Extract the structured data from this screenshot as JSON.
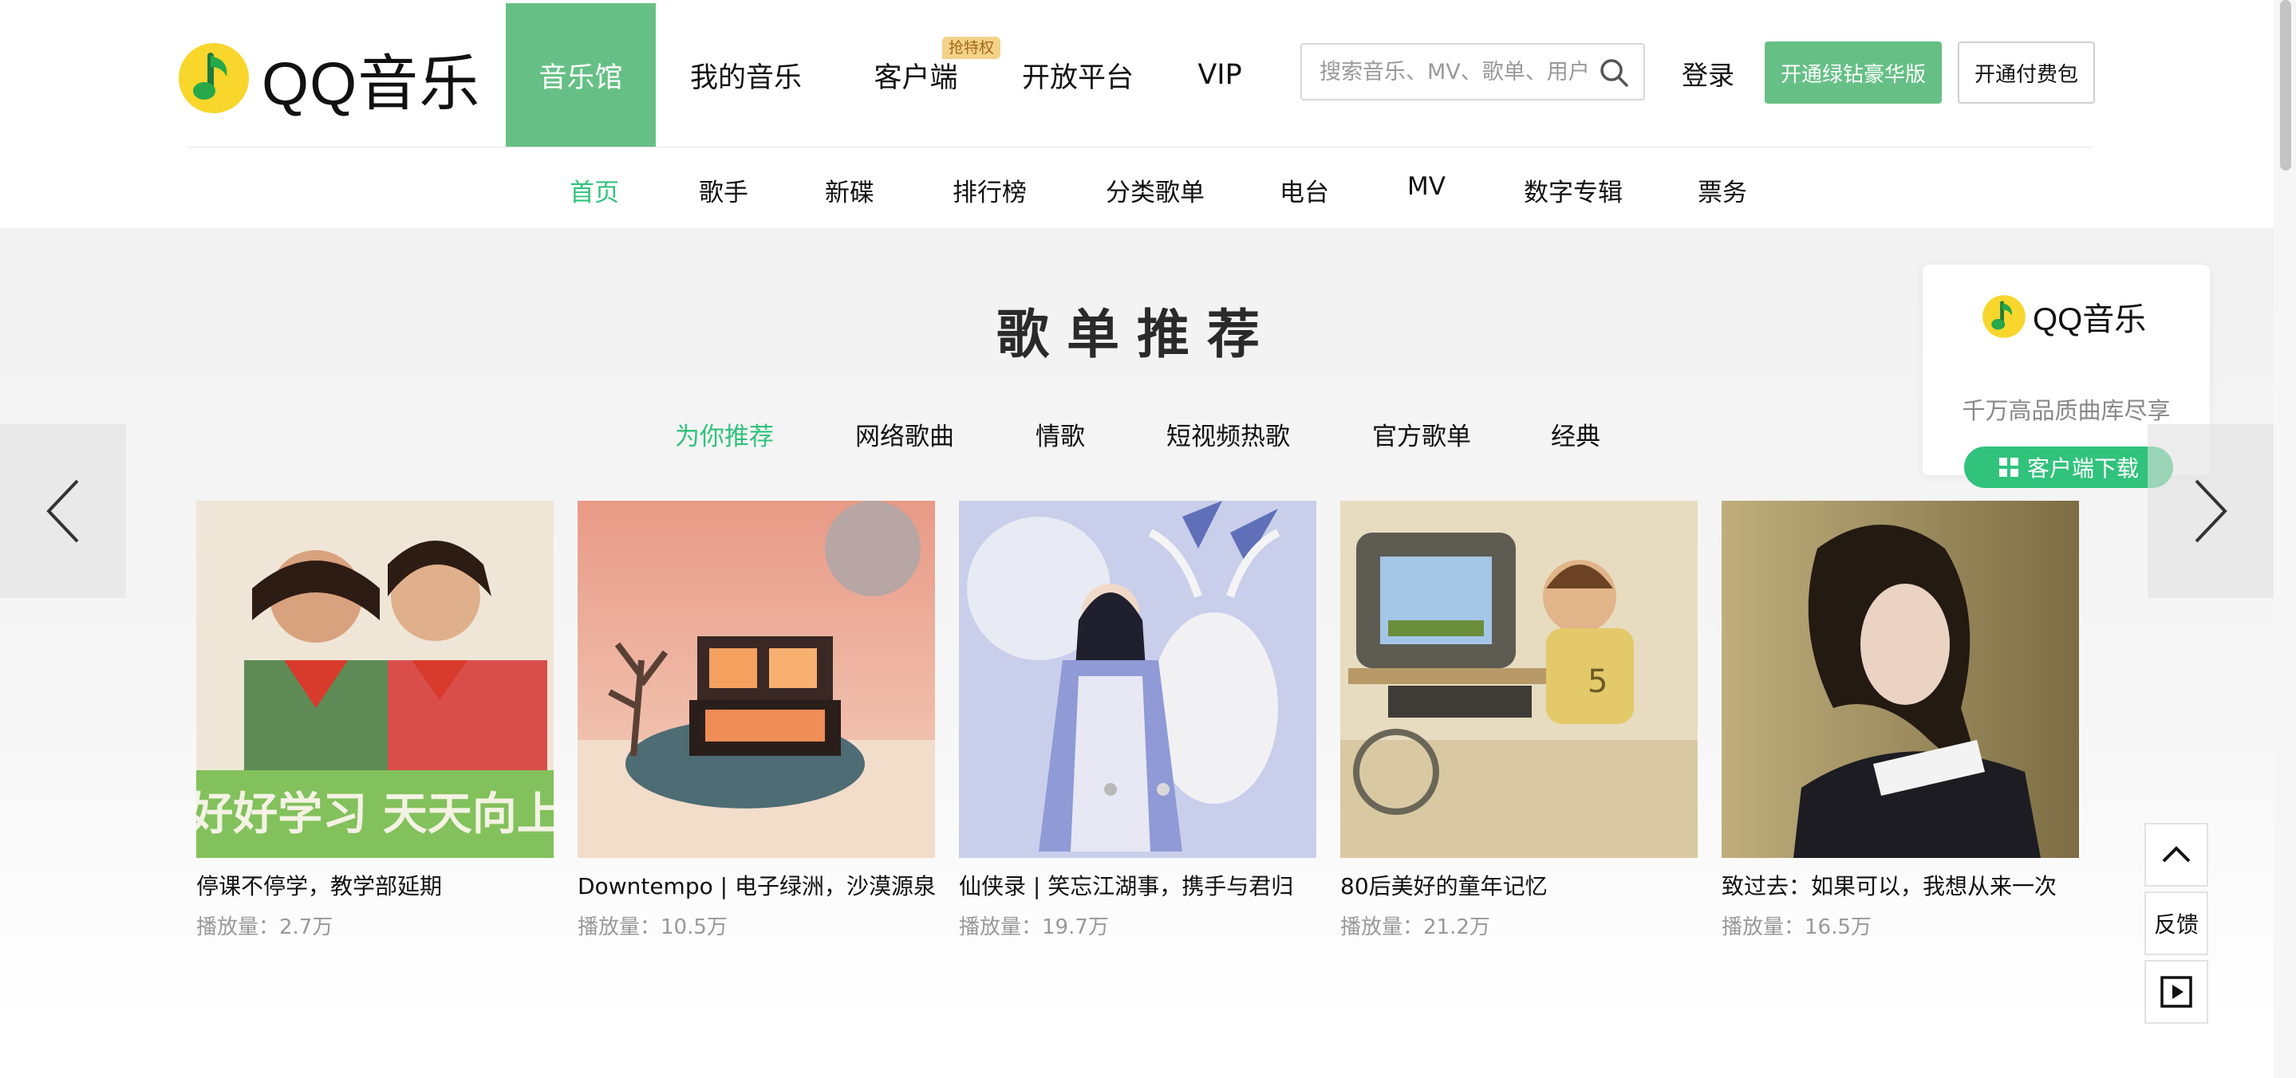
{
  "brand": {
    "name": "QQ音乐",
    "accent": "#66c085",
    "text_green": "#31c27c"
  },
  "nav_main": [
    {
      "label": "音乐馆",
      "active": true
    },
    {
      "label": "我的音乐"
    },
    {
      "label": "客户端",
      "badge": "抢特权"
    },
    {
      "label": "开放平台"
    },
    {
      "label": "VIP"
    }
  ],
  "search": {
    "placeholder": "搜索音乐、MV、歌单、用户",
    "icon": "search-icon"
  },
  "header_actions": {
    "login": "登录",
    "vip_button": "开通绿钻豪华版",
    "pay_button": "开通付费包"
  },
  "nav_sub": [
    "首页",
    "歌手",
    "新碟",
    "排行榜",
    "分类歌单",
    "电台",
    "MV",
    "数字专辑",
    "票务"
  ],
  "section": {
    "title": "歌单推荐",
    "tabs": [
      "为你推荐",
      "网络歌曲",
      "情歌",
      "短视频热歌",
      "官方歌单",
      "经典"
    ]
  },
  "promo": {
    "logo_text": "QQ音乐",
    "subtitle": "千万高品质曲库尽享",
    "button": "客户端下载"
  },
  "playlists": [
    {
      "title": "停课不停学，教学部延期",
      "plays": "播放量：2.7万",
      "cover_text": "好好学习 天天向上"
    },
    {
      "title": "Downtempo | 电子绿洲，沙漠源泉",
      "plays": "播放量：10.5万"
    },
    {
      "title": "仙侠录 | 笑忘江湖事，携手与君归",
      "plays": "播放量：19.7万"
    },
    {
      "title": "80后美好的童年记忆",
      "plays": "播放量：21.2万"
    },
    {
      "title": "致过去：如果可以，我想从来一次",
      "plays": "播放量：16.5万"
    }
  ],
  "carousel": {
    "pages": 2,
    "current": 1
  },
  "side_tools": {
    "feedback": "反馈"
  }
}
